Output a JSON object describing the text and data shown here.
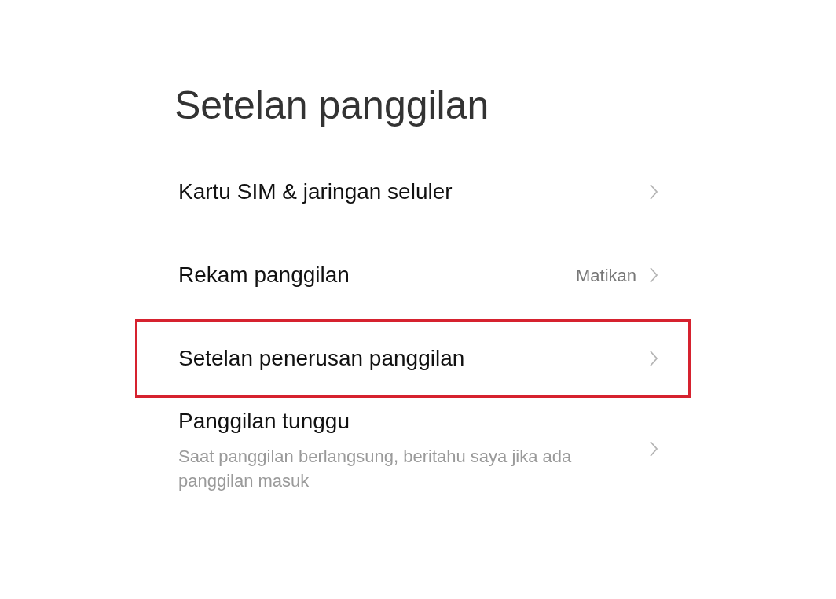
{
  "title": "Setelan panggilan",
  "items": [
    {
      "label": "Kartu SIM & jaringan seluler",
      "highlighted": false
    },
    {
      "label": "Rekam panggilan",
      "value": "Matikan",
      "highlighted": false
    },
    {
      "label": "Setelan penerusan panggilan",
      "highlighted": true
    },
    {
      "label": "Panggilan tunggu",
      "description": "Saat panggilan berlangsung, beritahu saya jika ada panggilan masuk",
      "highlighted": false
    }
  ]
}
